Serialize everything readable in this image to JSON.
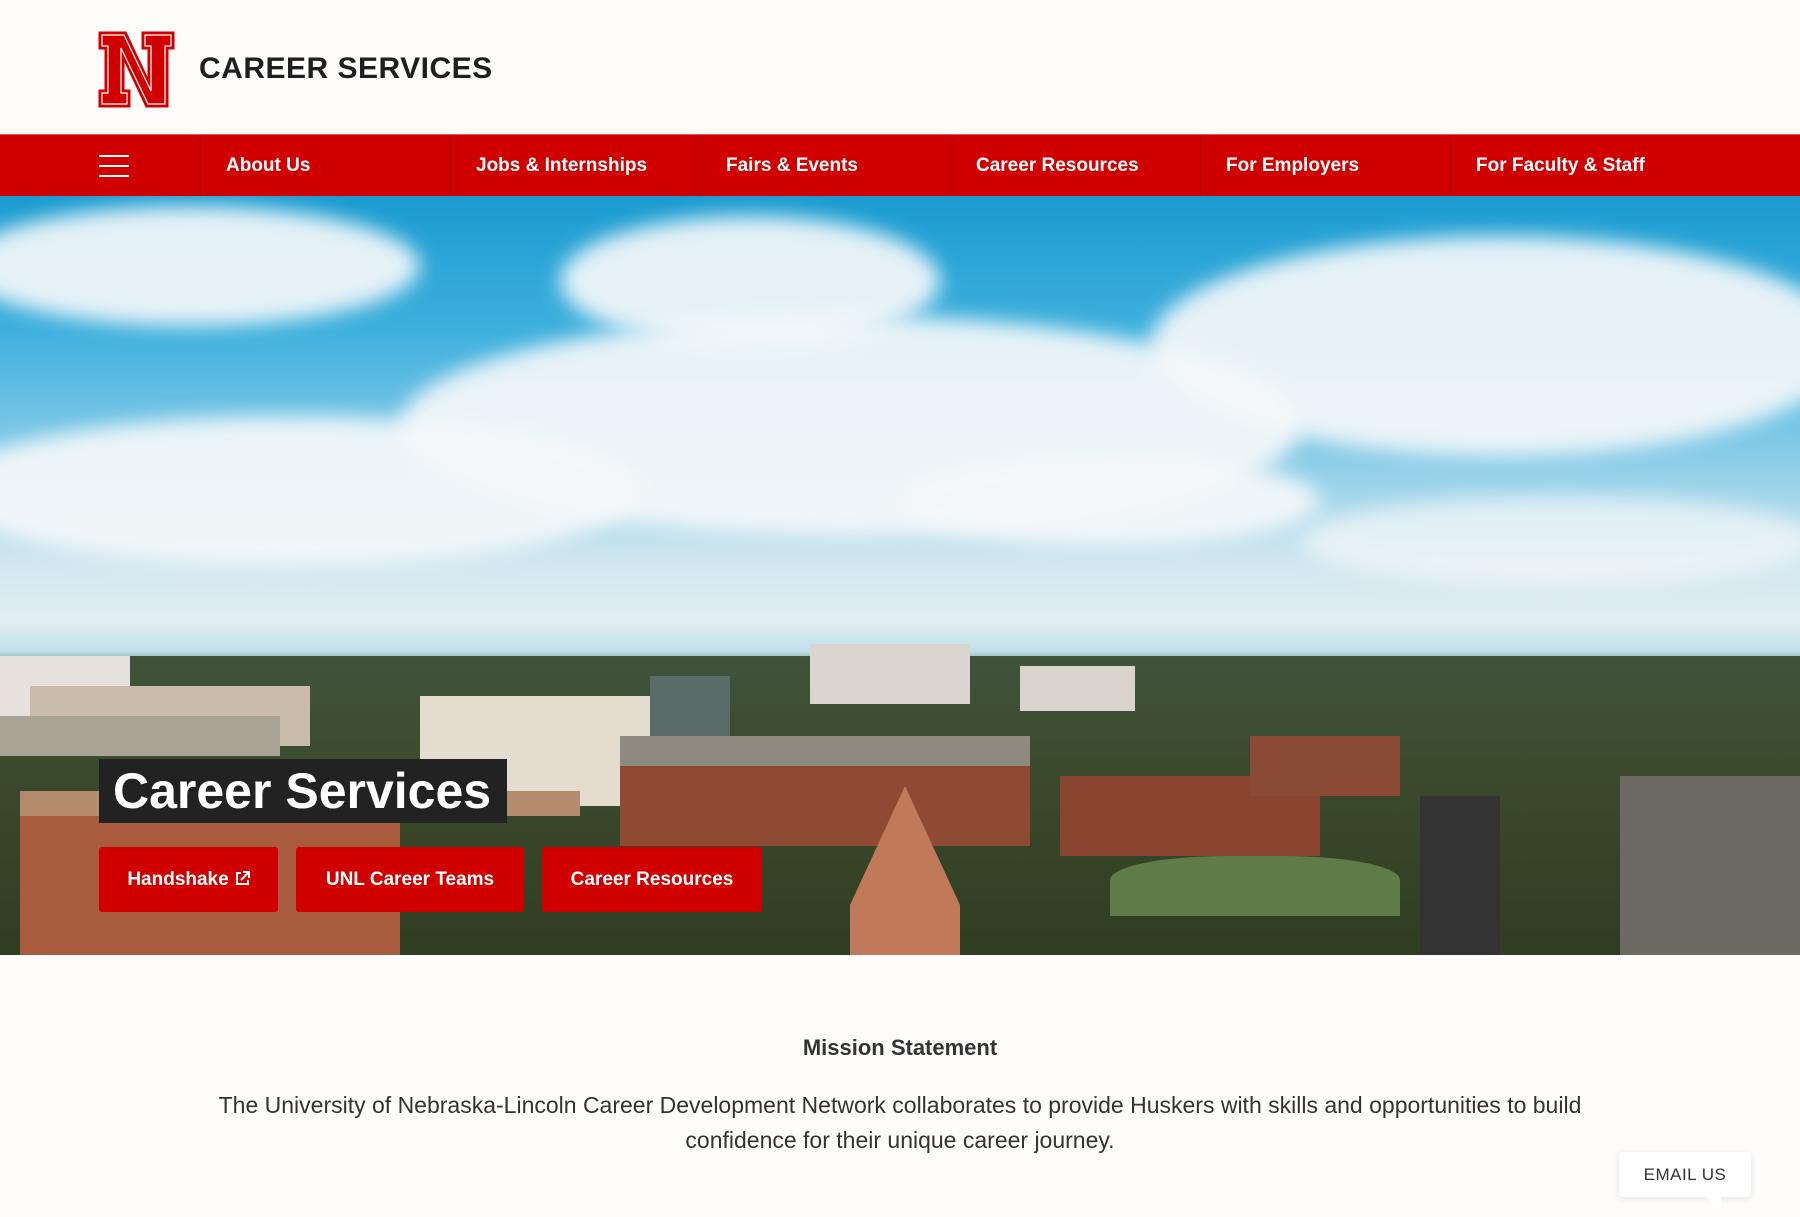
{
  "header": {
    "site_title": "CAREER SERVICES",
    "logo": "nebraska-n-logo",
    "brand_color": "#d00000"
  },
  "nav": {
    "menu_icon": "hamburger-icon",
    "items": [
      {
        "label": "About Us"
      },
      {
        "label": "Jobs & Internships"
      },
      {
        "label": "Fairs & Events"
      },
      {
        "label": "Career Resources"
      },
      {
        "label": "For Employers"
      },
      {
        "label": "For Faculty & Staff"
      }
    ]
  },
  "hero": {
    "image": "aerial-campus-photo",
    "title": "Career Services",
    "buttons": [
      {
        "label": "Handshake",
        "icon": "external-link-icon"
      },
      {
        "label": "UNL Career Teams"
      },
      {
        "label": "Career Resources"
      }
    ]
  },
  "mission": {
    "heading": "Mission Statement",
    "text": "The University of Nebraska-Lincoln Career Development Network collaborates to provide Huskers with skills and opportunities to build confidence for their unique career journey."
  },
  "email_widget": {
    "label": "EMAIL US"
  }
}
